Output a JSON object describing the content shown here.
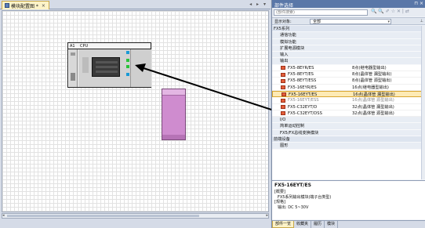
{
  "editor": {
    "tab_label": "模块配置图 *",
    "tab_close": "×",
    "pane_controls": "◂ ▸ ▾",
    "module": {
      "slot_a1_label": "A1",
      "cpu_label": "CPU"
    }
  },
  "parts_panel": {
    "title": "部件选择",
    "pin": "⊓ ×",
    "search_placeholder": "(部件搜索)",
    "toolbar_icons": "🔍 🔍 ✐ ☆ ✕ | ⇄",
    "filter_label": "显示对象:",
    "filter_value": "全部",
    "filter_dropdown": "▾",
    "collapse": "⊥",
    "rows": [
      {
        "kind": "cat",
        "label": "FX5系列"
      },
      {
        "kind": "sub",
        "label": "通信功能"
      },
      {
        "kind": "sub",
        "label": "模拟功能"
      },
      {
        "kind": "sub",
        "label": "扩展电源模块"
      },
      {
        "kind": "sub",
        "label": "输入"
      },
      {
        "kind": "sub",
        "label": "输出"
      },
      {
        "kind": "item",
        "name": "FX5-8EYR/ES",
        "desc": "8点(继电器型输出)"
      },
      {
        "kind": "item",
        "name": "FX5-8EYT/ES",
        "desc": "8点(晶体管 漏型输出)"
      },
      {
        "kind": "item",
        "name": "FX5-8EYT/ESS",
        "desc": "8点(晶体管 源型输出)"
      },
      {
        "kind": "item",
        "name": "FX5-16EYR/ES",
        "desc": "16点(继电器型输出)"
      },
      {
        "kind": "item",
        "name": "FX5-16EYT/ES",
        "desc": "16点(晶体管 漏型输出)",
        "selected": true
      },
      {
        "kind": "item",
        "name": "FX5-16EYT/ESS",
        "desc": "16点(晶体管 源型输出)",
        "faded": true
      },
      {
        "kind": "item",
        "name": "FX5-C32EYT/D",
        "desc": "32点(晶体管 漏型输出)"
      },
      {
        "kind": "item",
        "name": "FX5-C32EYT/DSS",
        "desc": "32点(晶体管 源型输出)"
      },
      {
        "kind": "sub",
        "label": "I/O"
      },
      {
        "kind": "sub",
        "label": "简单运动控制"
      },
      {
        "kind": "sub",
        "label": "FX5/FX总线变换模块"
      },
      {
        "kind": "cat",
        "label": "前端设备"
      },
      {
        "kind": "sub",
        "label": "图形"
      }
    ],
    "detail": {
      "title": "FX5-16EYT/ES",
      "summary_label": "[概要]",
      "summary_text": "FX5系列输出模块(端子台类型)",
      "spec_label": "[规格]",
      "spec_text": "输出: DC 5~30V"
    },
    "bottom_tabs": [
      "部件一览",
      "收藏夹",
      "履历",
      "模块"
    ]
  },
  "colors": {
    "title_bar": "#5a77a8",
    "selected_row": "#fdeab5",
    "placed_module": "#cf8ccf",
    "part_icon": "#e35e3a"
  }
}
